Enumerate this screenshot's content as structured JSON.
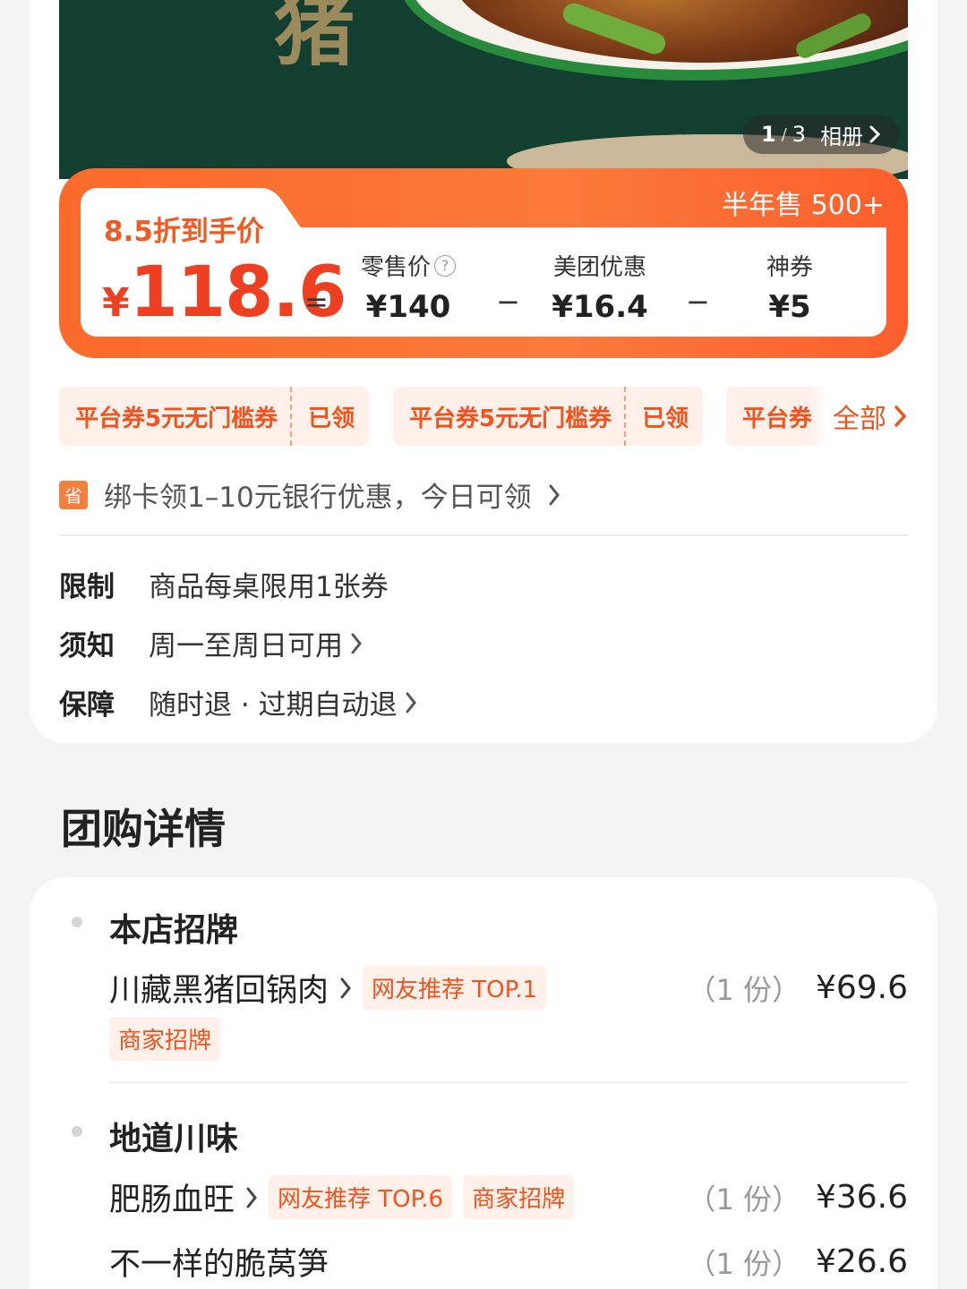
{
  "hero": {
    "watermark_char": "猪",
    "album": {
      "current": "1",
      "separator": "/",
      "total": "3",
      "label": "相册"
    }
  },
  "price": {
    "sold_label": "半年售 500+",
    "discount_label": "8.5折到手价",
    "currency": "¥",
    "final_price": "118.6",
    "equals": "=",
    "minus": "−",
    "retail": {
      "label": "零售价",
      "value": "¥140"
    },
    "meituan": {
      "label": "美团优惠",
      "value": "¥16.4"
    },
    "coupon": {
      "label": "神券",
      "value": "¥5"
    }
  },
  "coupons": {
    "items": [
      {
        "name": "平台券5元无门槛券",
        "state": "已领"
      },
      {
        "name": "平台券5元无门槛券",
        "state": "已领"
      },
      {
        "name": "平台券",
        "state": ""
      }
    ],
    "all_label": "全部"
  },
  "bank": {
    "icon_text": "省",
    "text": "绑卡领1–10元银行优惠，今日可领"
  },
  "rules": [
    {
      "key": "限制",
      "value": "商品每桌限用1张券"
    },
    {
      "key": "须知",
      "value": "周一至周日可用"
    },
    {
      "key": "保障",
      "value": "随时退 · 过期自动退"
    }
  ],
  "details": {
    "title": "团购详情",
    "groups": [
      {
        "title": "本店招牌",
        "items": [
          {
            "name": "川藏黑猪回锅肉",
            "tags": [
              "网友推荐 TOP.1",
              "商家招牌"
            ],
            "qty": "（1 份）",
            "price": "¥69.6"
          }
        ]
      },
      {
        "title": "地道川味",
        "items": [
          {
            "name": "肥肠血旺",
            "tags": [
              "网友推荐 TOP.6",
              "商家招牌"
            ],
            "qty": "（1 份）",
            "price": "¥36.6"
          },
          {
            "name": "不一样的脆莴笋",
            "tags": [],
            "qty": "（1 份）",
            "price": "¥26.6"
          }
        ]
      }
    ]
  },
  "colors": {
    "accent": "#f2531d",
    "price_red": "#ee3f20",
    "hero_green": "#123f2f"
  }
}
